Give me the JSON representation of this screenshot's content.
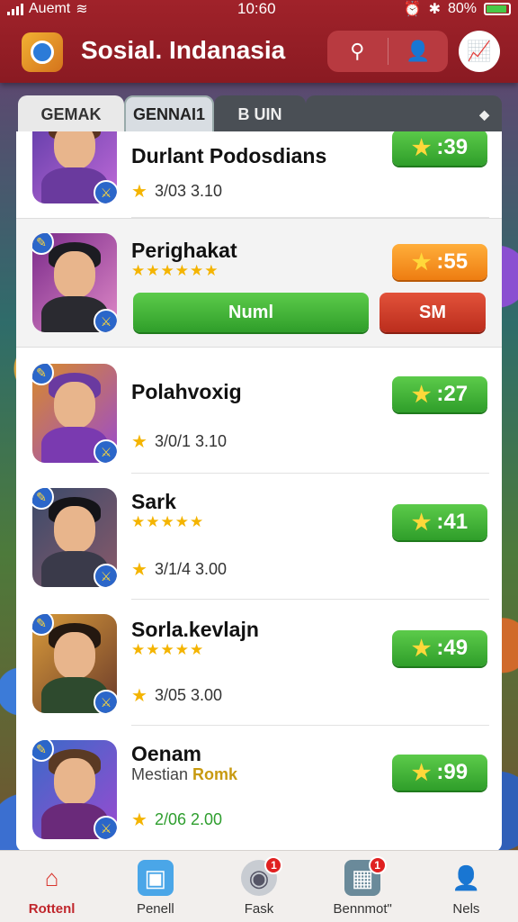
{
  "status_bar": {
    "carrier": "Auemt",
    "time": "10:60",
    "battery": "80%"
  },
  "header": {
    "title": "Sosial. Indanasia"
  },
  "tabs": [
    {
      "label": "GEMAK"
    },
    {
      "label": "GENNAI1"
    },
    {
      "label": "B UIN"
    },
    {
      "label": ""
    }
  ],
  "rows": [
    {
      "name": "Durlant Podosdians",
      "meta": "3/03 3.10",
      "score": ":39",
      "score_color": "green"
    },
    {
      "name": "Perighakat",
      "stars": "★★★★★★",
      "score": ":55",
      "score_color": "orange",
      "primary_action": "Numl",
      "secondary_action": "SM"
    },
    {
      "name": "Polahvoxig",
      "meta": "3/0/1 3.10",
      "score": ":27",
      "score_color": "green"
    },
    {
      "name": "Sark",
      "stars": "★★★★★",
      "meta": "3/1/4 3.00",
      "score": ":41",
      "score_color": "green"
    },
    {
      "name": "Sorla.kevlajn",
      "stars": "★★★★★",
      "meta": "3/05 3.00",
      "score": ":49",
      "score_color": "green"
    },
    {
      "name": "Oenam",
      "sub_prefix": "Mestian",
      "sub_highlight": "Romk",
      "meta": "2/06 2.00",
      "score": ":99",
      "score_color": "green"
    }
  ],
  "bottom_nav": [
    {
      "label": "Rottenl",
      "icon": "home-icon",
      "active": true
    },
    {
      "label": "Penell",
      "icon": "cube-icon"
    },
    {
      "label": "Fask",
      "icon": "robot-icon",
      "badge": "1"
    },
    {
      "label": "Bennmot\"",
      "icon": "calendar-icon",
      "badge": "1"
    },
    {
      "label": "Nels",
      "icon": "person-icon"
    }
  ]
}
